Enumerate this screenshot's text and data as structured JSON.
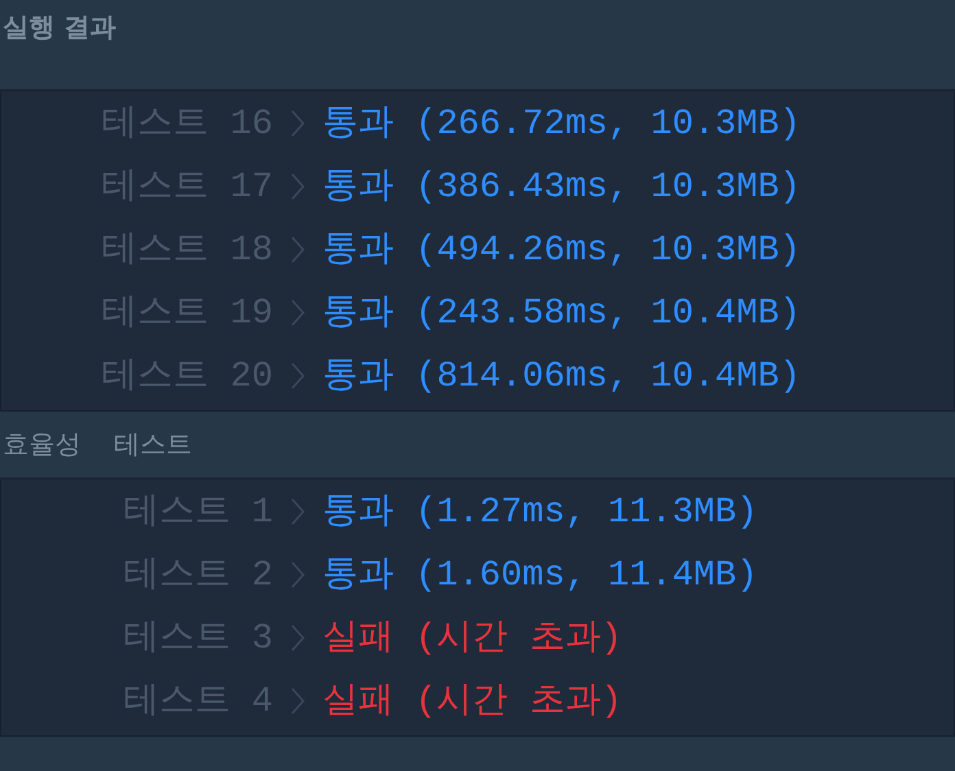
{
  "title": "실행 결과",
  "groups": [
    {
      "tests": [
        {
          "label": "테스트 16",
          "passed": true,
          "result": "통과 (266.72ms, 10.3MB)"
        },
        {
          "label": "테스트 17",
          "passed": true,
          "result": "통과 (386.43ms, 10.3MB)"
        },
        {
          "label": "테스트 18",
          "passed": true,
          "result": "통과 (494.26ms, 10.3MB)"
        },
        {
          "label": "테스트 19",
          "passed": true,
          "result": "통과 (243.58ms, 10.4MB)"
        },
        {
          "label": "테스트 20",
          "passed": true,
          "result": "통과 (814.06ms, 10.4MB)"
        }
      ]
    },
    {
      "heading": [
        "효율성",
        "테스트"
      ],
      "tests": [
        {
          "label": "테스트 1",
          "passed": true,
          "result": "통과 (1.27ms, 11.3MB)"
        },
        {
          "label": "테스트 2",
          "passed": true,
          "result": "통과 (1.60ms, 11.4MB)"
        },
        {
          "label": "테스트 3",
          "passed": false,
          "result": "실패 (시간 초과)"
        },
        {
          "label": "테스트 4",
          "passed": false,
          "result": "실패 (시간 초과)"
        }
      ]
    }
  ]
}
